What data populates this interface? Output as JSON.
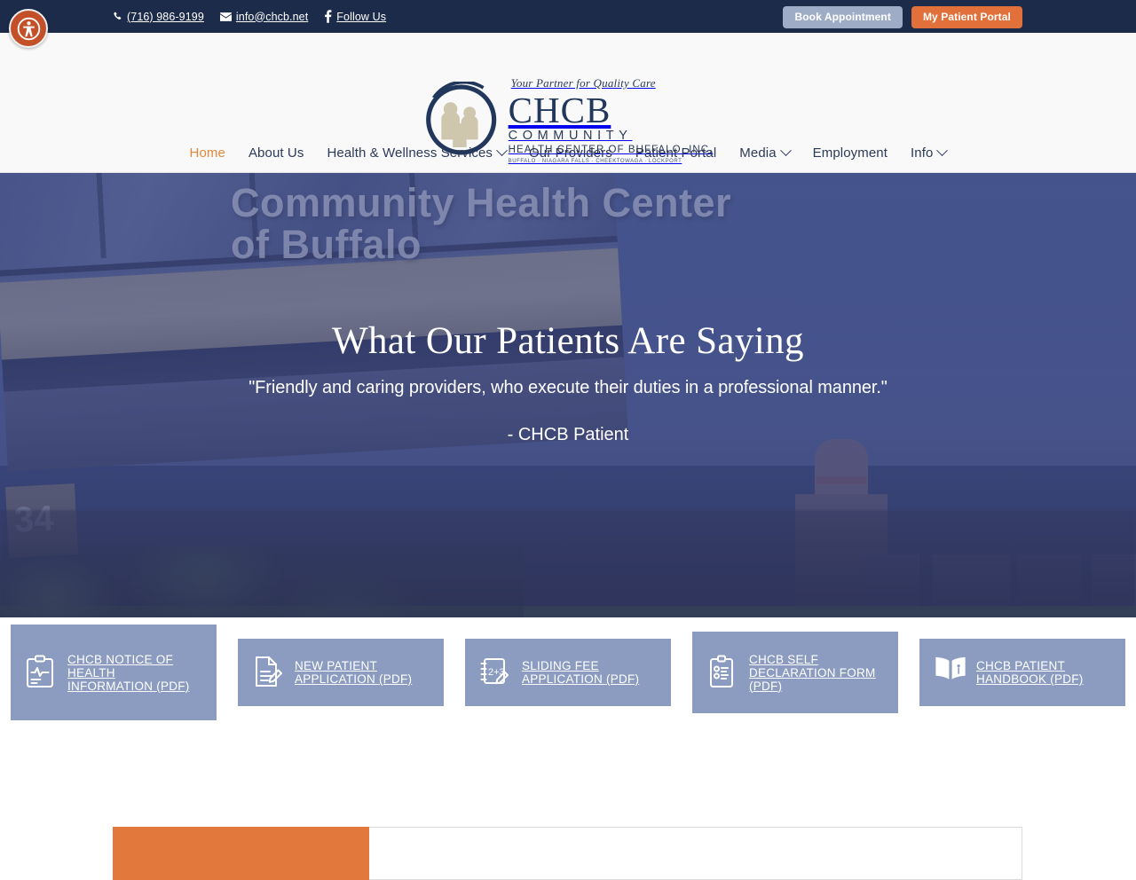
{
  "accessibility": {
    "name": "accessibility-widget",
    "label": "Accessibility Options"
  },
  "topbar": {
    "phone": "(716) 986-9199",
    "email": "info@chcb.net",
    "social": "Follow Us",
    "book_label": "Book Appointment",
    "portal_label": "My Patient Portal",
    "bg_color": "#1c2b4a",
    "book_color": "#9facc6",
    "portal_color": "#e2703a"
  },
  "logo": {
    "tagline": "Your Partner for Quality Care",
    "acronym": "CHCB",
    "community": "COMMUNITY",
    "full_name": "HEALTH CENTER OF BUFFALO, INC.",
    "cities": "BUFFALO  ·  NIAGARA FALLS  ·  CHEEKTOWAGA · LOCKPORT"
  },
  "nav": {
    "items": [
      {
        "label": "Home",
        "active": true,
        "caret": false
      },
      {
        "label": "About Us",
        "active": false,
        "caret": false
      },
      {
        "label": "Health & Wellness Services",
        "active": false,
        "caret": true
      },
      {
        "label": "Our Providers",
        "active": false,
        "caret": false
      },
      {
        "label": "Patient Portal",
        "active": false,
        "caret": false
      },
      {
        "label": "Media",
        "active": false,
        "caret": true
      },
      {
        "label": "Employment",
        "active": false,
        "caret": false
      },
      {
        "label": "Info",
        "active": false,
        "caret": true
      }
    ],
    "active_color": "#e2883a",
    "text_color": "#2b3a59"
  },
  "hero": {
    "title": "What Our Patients Are Saying",
    "quote": "\"Friendly and caring providers, who execute their duties in a professional manner.\"",
    "attribution": "- CHCB Patient",
    "background_sign_line1": "Community Health Center",
    "background_sign_line2": "of Buffalo",
    "building_number": "34",
    "overlay_color": "#3e4a86"
  },
  "cards": {
    "bg_color": "#8c9cc0",
    "items": [
      {
        "label": "CHCB NOTICE OF HEALTH INFORMATION (PDF)",
        "icon": "clipboard-pulse-icon"
      },
      {
        "label": "NEW PATIENT APPLICATION (PDF)",
        "icon": "document-pencil-icon"
      },
      {
        "label": "SLIDING FEE APPLICATION (PDF)",
        "icon": "calculator-pencil-icon"
      },
      {
        "label": "CHCB SELF DECLARATION FORM (PDF)",
        "icon": "clipboard-checklist-icon"
      },
      {
        "label": "CHCB PATIENT HANDBOOK (PDF)",
        "icon": "open-book-icon"
      }
    ]
  },
  "panel": {
    "tab_color": "#e2783c"
  }
}
